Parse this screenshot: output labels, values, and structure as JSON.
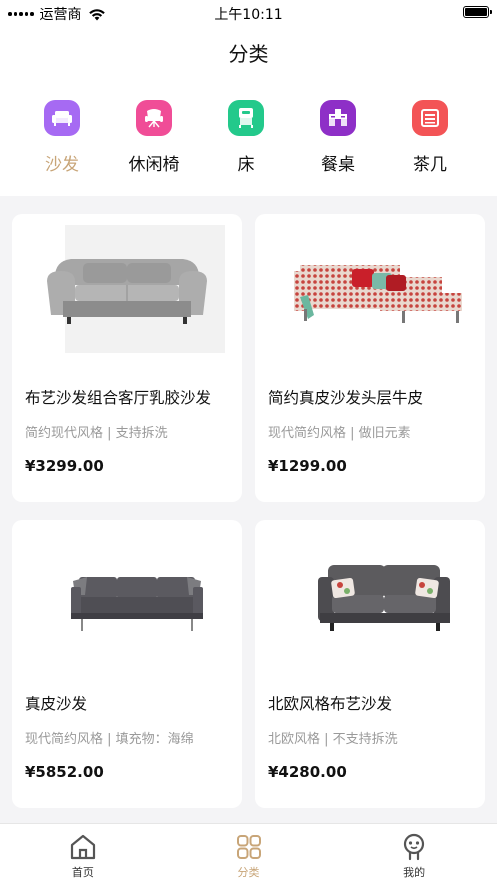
{
  "status_bar": {
    "carrier": "运营商",
    "time": "上午10:11"
  },
  "header": {
    "title": "分类"
  },
  "categories": [
    {
      "label": "沙发",
      "icon": "sofa-icon",
      "color": "#a66af3",
      "active": true
    },
    {
      "label": "休闲椅",
      "icon": "armchair-icon",
      "color": "#f04d97",
      "active": false
    },
    {
      "label": "床",
      "icon": "bed-icon",
      "color": "#23c98b",
      "active": false
    },
    {
      "label": "餐桌",
      "icon": "dining-table-icon",
      "color": "#8e2fc7",
      "active": false
    },
    {
      "label": "茶几",
      "icon": "coffee-table-icon",
      "color": "#f35456",
      "active": false
    }
  ],
  "products": [
    {
      "title": "布艺沙发组合客厅乳胶沙发",
      "tags": "简约现代风格 | 支持拆洗",
      "price": "¥3299.00"
    },
    {
      "title": "简约真皮沙发头层牛皮",
      "tags": "现代简约风格 | 做旧元素",
      "price": "¥1299.00"
    },
    {
      "title": "真皮沙发",
      "tags": "现代简约风格 | 填充物：海绵",
      "price": "¥5852.00"
    },
    {
      "title": "北欧风格布艺沙发",
      "tags": "北欧风格 | 不支持拆洗",
      "price": "¥4280.00"
    }
  ],
  "tab_bar": [
    {
      "label": "首页",
      "icon": "home-icon",
      "active": false
    },
    {
      "label": "分类",
      "icon": "category-icon",
      "active": true
    },
    {
      "label": "我的",
      "icon": "profile-icon",
      "active": false
    }
  ],
  "colors": {
    "accent": "#c8a578",
    "background": "#f4f4f6"
  }
}
